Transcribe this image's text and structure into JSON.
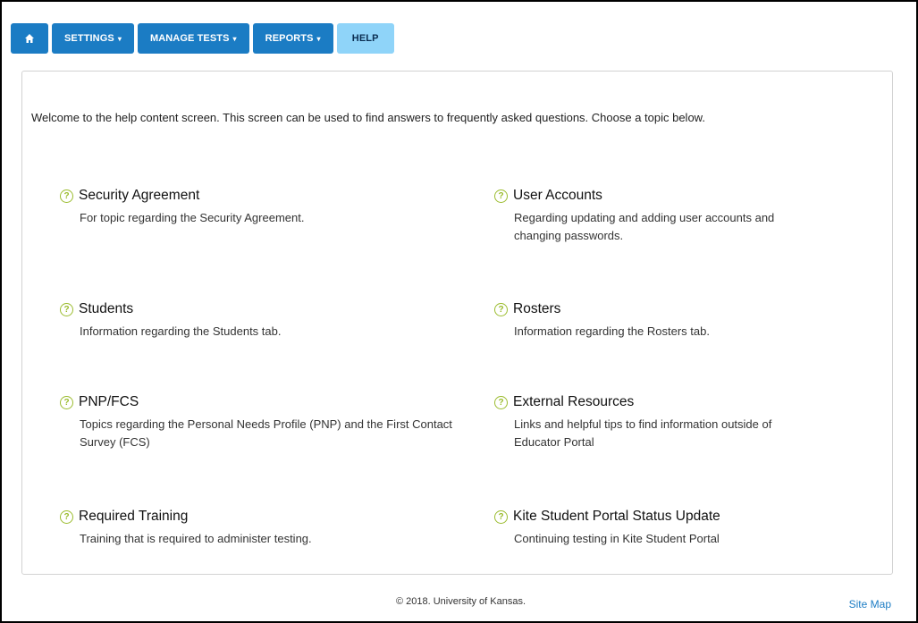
{
  "nav": {
    "home_icon": "home-icon",
    "items": [
      {
        "label": "SETTINGS",
        "has_caret": true
      },
      {
        "label": "MANAGE TESTS",
        "has_caret": true
      },
      {
        "label": "REPORTS",
        "has_caret": true
      },
      {
        "label": "HELP",
        "has_caret": false,
        "active": true
      }
    ],
    "caret": "▾"
  },
  "intro": "Welcome to the help content screen. This screen can be used to find answers to frequently asked questions. Choose a topic below.",
  "topics": [
    {
      "title": "Security Agreement",
      "description": "For topic regarding the Security Agreement."
    },
    {
      "title": "User Accounts",
      "description": "Regarding updating and adding user accounts and changing passwords."
    },
    {
      "title": "Students",
      "description": "Information regarding the Students tab."
    },
    {
      "title": "Rosters",
      "description": "Information regarding the Rosters tab."
    },
    {
      "title": "PNP/FCS",
      "description": "Topics regarding the Personal Needs Profile (PNP) and the First Contact Survey (FCS)"
    },
    {
      "title": "External Resources",
      "description": "Links and helpful tips to find information outside of Educator Portal"
    },
    {
      "title": "Required Training",
      "description": "Training that is required to administer testing."
    },
    {
      "title": "Kite Student Portal Status Update",
      "description": "Continuing testing in Kite Student Portal"
    }
  ],
  "help_icon_glyph": "?",
  "footer": {
    "copyright": "© 2018. University of Kansas.",
    "site_map": "Site Map"
  },
  "colors": {
    "nav_blue": "#1b7cc4",
    "nav_active": "#8fd4f9",
    "help_icon": "#9bbc2e"
  }
}
